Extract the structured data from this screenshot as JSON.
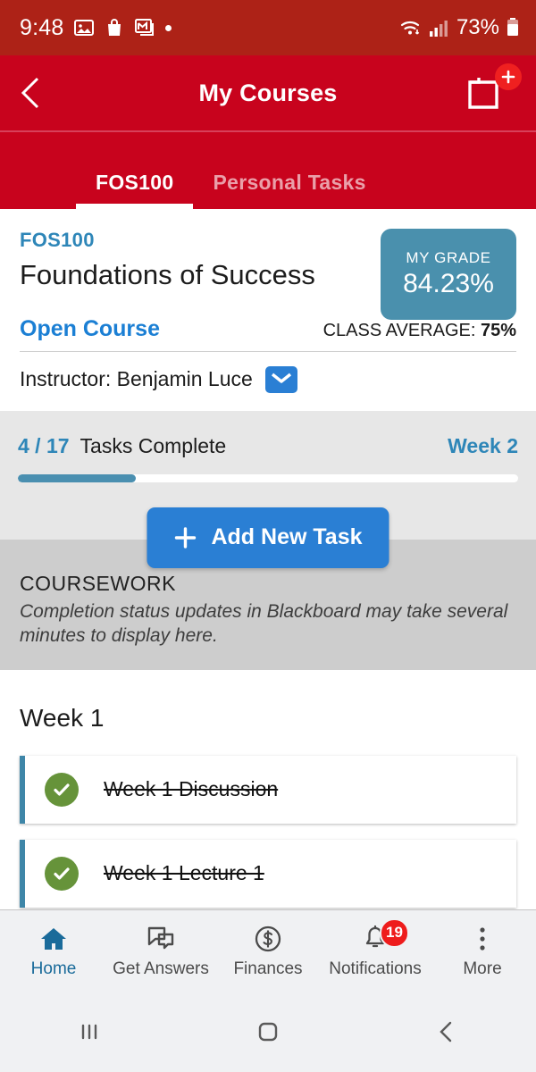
{
  "status_bar": {
    "time": "9:48",
    "battery_pct": "73%",
    "icons": [
      "photos-icon",
      "shopping-bag-icon",
      "gmail-icon",
      "dot-icon",
      "wifi-icon",
      "cellular-signal-icon",
      "battery-icon"
    ]
  },
  "header": {
    "title": "My Courses",
    "back_icon": "chevron-left-icon",
    "action_icon": "calendar-add-icon",
    "action_badge": "+"
  },
  "tabs": [
    {
      "label": "FOS100",
      "active": true
    },
    {
      "label": "Personal Tasks",
      "active": false
    }
  ],
  "course": {
    "code": "FOS100",
    "title": "Foundations of Success",
    "grade_label": "MY GRADE",
    "grade_value": "84.23%",
    "open_course_link": "Open Course",
    "class_average_label": "CLASS AVERAGE:",
    "class_average_value": "75%",
    "instructor": "Instructor: Benjamin Luce",
    "mail_icon": "envelope-icon"
  },
  "progress": {
    "fraction": "4 / 17",
    "text": "Tasks Complete",
    "week": "Week 2",
    "percent": 23.5,
    "completed": 4,
    "total": 17
  },
  "add_task": {
    "label": "Add New Task",
    "icon": "plus-icon"
  },
  "coursework": {
    "title": "COURSEWORK",
    "note": "Completion status updates in Blackboard may take several minutes to display here."
  },
  "week_section": {
    "heading": "Week 1",
    "tasks": [
      {
        "label": "Week 1 Discussion",
        "complete": true,
        "icon": "check-circle-icon"
      },
      {
        "label": "Week 1 Lecture 1",
        "complete": true,
        "icon": "check-circle-icon"
      }
    ]
  },
  "bottom_nav": [
    {
      "label": "Home",
      "icon": "home-icon",
      "active": true,
      "badge": ""
    },
    {
      "label": "Get Answers",
      "icon": "chat-icon",
      "active": false,
      "badge": ""
    },
    {
      "label": "Finances",
      "icon": "dollar-circle-icon",
      "active": false,
      "badge": ""
    },
    {
      "label": "Notifications",
      "icon": "bell-icon",
      "active": false,
      "badge": "19"
    },
    {
      "label": "More",
      "icon": "kebab-menu-icon",
      "active": false,
      "badge": ""
    }
  ],
  "system_nav": {
    "recents_icon": "recents-icon",
    "home_icon": "home-square-icon",
    "back_icon": "back-chevron-icon"
  },
  "colors": {
    "status_bar": "#ad2217",
    "header": "#c8031d",
    "accent_blue": "#2a7fd4",
    "teal": "#4a90ad",
    "green": "#66933a",
    "badge_red": "#ee1c1c"
  }
}
